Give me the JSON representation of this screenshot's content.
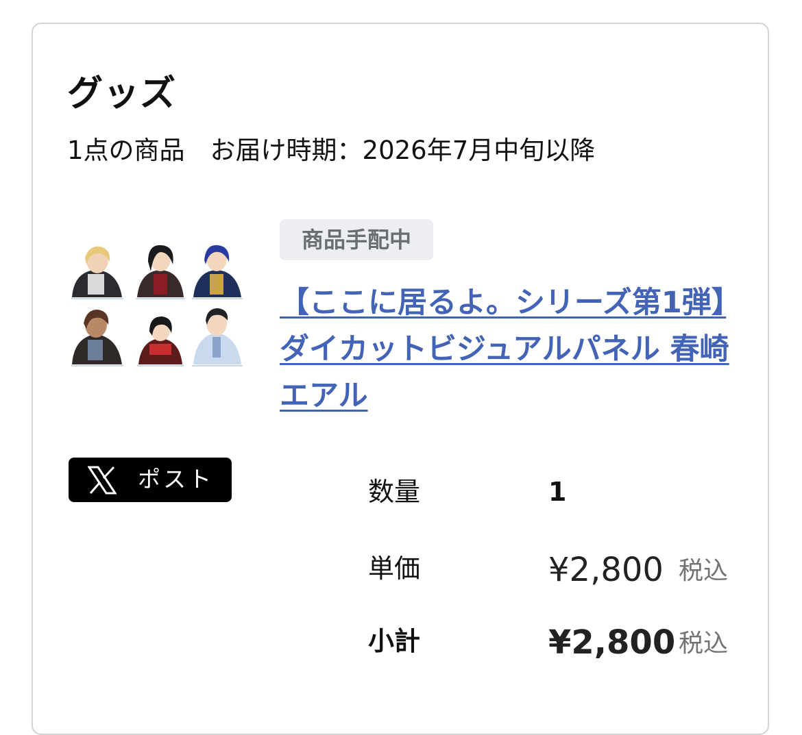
{
  "section": {
    "title": "グッズ",
    "summary": "1点の商品　お届け時期：2026年7月中旬以降"
  },
  "product": {
    "status": "商品手配中",
    "name": "【ここに居るよ。シリーズ第1弾】ダイカットビジュアルパネル 春崎エアル",
    "thumbnail_icon": "character-panel-thumbnail"
  },
  "share": {
    "label": "ポスト",
    "icon": "x-logo-icon"
  },
  "details": {
    "quantity_label": "数量",
    "quantity_value": "1",
    "unit_price_label": "単価",
    "unit_price_value": "¥2,800",
    "unit_price_tax": "税込",
    "subtotal_label": "小計",
    "subtotal_value": "¥2,800",
    "subtotal_tax": "税込"
  },
  "colors": {
    "link": "#4363b6",
    "badge_bg": "#eceef1",
    "badge_text": "#6a6d72",
    "border": "#d3d3d3",
    "tax_text": "#737373"
  }
}
